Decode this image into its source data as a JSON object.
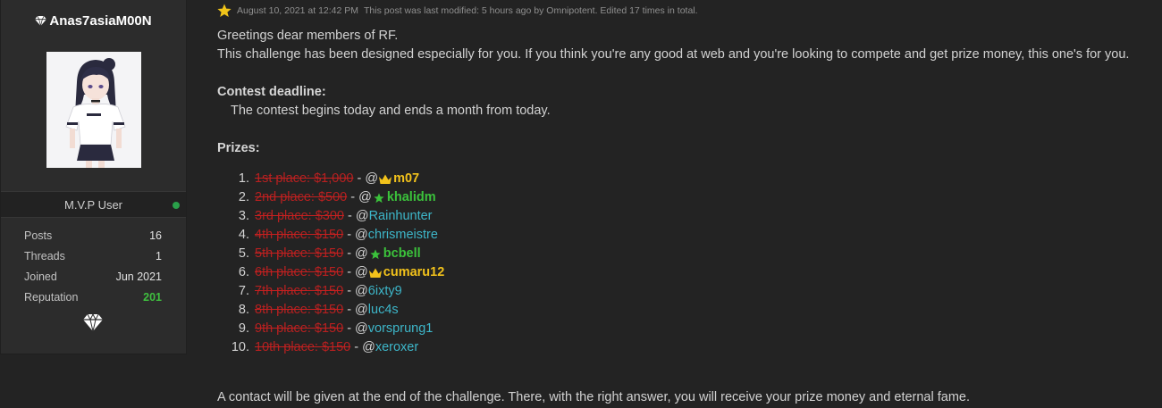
{
  "profile": {
    "username": "Anas7asiaM00N",
    "rank": "M.V.P User",
    "stats": [
      {
        "label": "Posts",
        "value": "16"
      },
      {
        "label": "Threads",
        "value": "1"
      },
      {
        "label": "Joined",
        "value": "Jun 2021"
      },
      {
        "label": "Reputation",
        "value": "201"
      }
    ],
    "icons": {
      "username_badge": "diamond-icon",
      "rank_badge": "diamond-icon"
    },
    "colors": {
      "online": "#2aa04a",
      "reputation": "#3fbf3f"
    }
  },
  "post": {
    "date": "August 10, 2021 at 12:42 PM",
    "modified_note": "This post was last modified: 5 hours ago by Omnipotent. Edited 17 times in total.",
    "greeting": "Greetings dear members of RF.",
    "intro": "This challenge has been designed especially for you. If you think you're any good at web and you're looking to compete and get prize money, this one's for you.",
    "deadline_heading": "Contest deadline:",
    "deadline_text": "The contest begins today and ends a month from today.",
    "prizes_heading": "Prizes:",
    "prizes": [
      {
        "num": "1.",
        "place": "1st place: $1,000",
        "user": "m07",
        "style": "gold",
        "icon": "crown-icon"
      },
      {
        "num": "2.",
        "place": "2nd place: $500",
        "user": "khalidm",
        "style": "green",
        "icon": "star-icon"
      },
      {
        "num": "3.",
        "place": "3rd place: $300",
        "user": "Rainhunter",
        "style": "plain",
        "icon": ""
      },
      {
        "num": "4.",
        "place": "4th place: $150",
        "user": "chrismeistre",
        "style": "plain",
        "icon": ""
      },
      {
        "num": "5.",
        "place": "5th place: $150",
        "user": "bcbell",
        "style": "green",
        "icon": "star-icon"
      },
      {
        "num": "6.",
        "place": "6th place: $150",
        "user": "cumaru12",
        "style": "gold",
        "icon": "crown-icon"
      },
      {
        "num": "7.",
        "place": "7th place: $150",
        "user": "6ixty9",
        "style": "plain",
        "icon": ""
      },
      {
        "num": "8.",
        "place": "8th place: $150",
        "user": "luc4s",
        "style": "plain",
        "icon": ""
      },
      {
        "num": "9.",
        "place": "9th place: $150",
        "user": "vorsprung1",
        "style": "plain",
        "icon": ""
      },
      {
        "num": "10.",
        "place": "10th place: $150",
        "user": "xeroxer",
        "style": "plain",
        "icon": ""
      }
    ],
    "separator": " - @",
    "footer": "A contact will be given at the end of the challenge. There, with the right answer, you will receive your prize money and eternal fame."
  },
  "colors": {
    "strike": "#b82020",
    "user_link": "#3db6c9",
    "gold": "#f2c21b",
    "green": "#3bc23b"
  }
}
